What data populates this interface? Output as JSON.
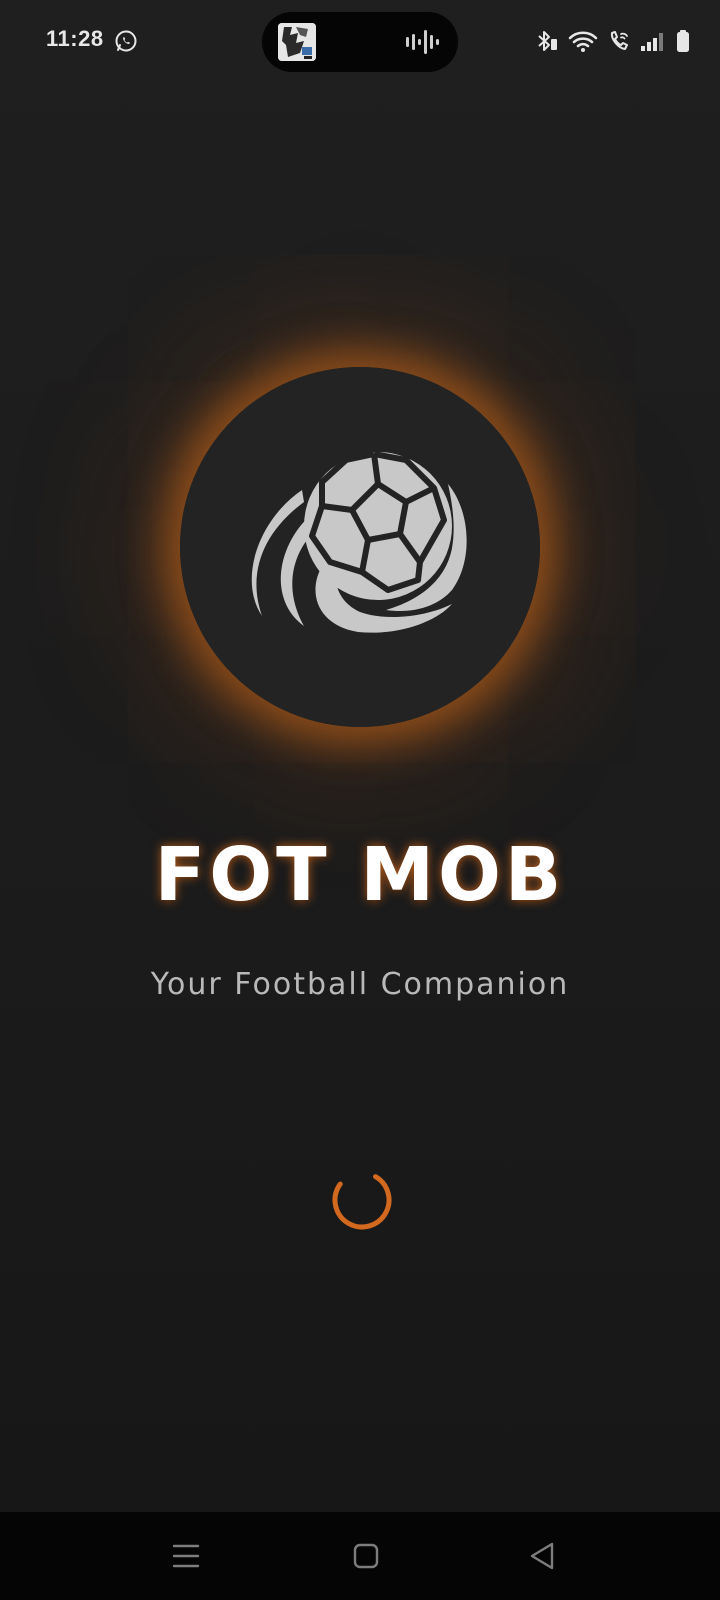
{
  "status_bar": {
    "time": "11:28",
    "icons": [
      "whatsapp-icon",
      "bluetooth-icon",
      "wifi-icon",
      "wifi-calling-icon",
      "signal-icon",
      "battery-icon"
    ]
  },
  "dynamic_island": {
    "icons": [
      "media-thumbnail",
      "audio-wave-icon"
    ]
  },
  "app": {
    "title": "FOT MOB",
    "subtitle": "Your Football Companion",
    "logo_icon": "soccer-ball-icon",
    "loading_indicator": "spinner"
  },
  "colors": {
    "background": "#1c1c1c",
    "accent": "#d2691e",
    "logo_circle": "#232323",
    "ball": "#c8c8c8",
    "subtitle": "#b9b9b9"
  },
  "nav_bar": {
    "buttons": [
      "menu-icon",
      "home-icon",
      "back-icon"
    ]
  }
}
